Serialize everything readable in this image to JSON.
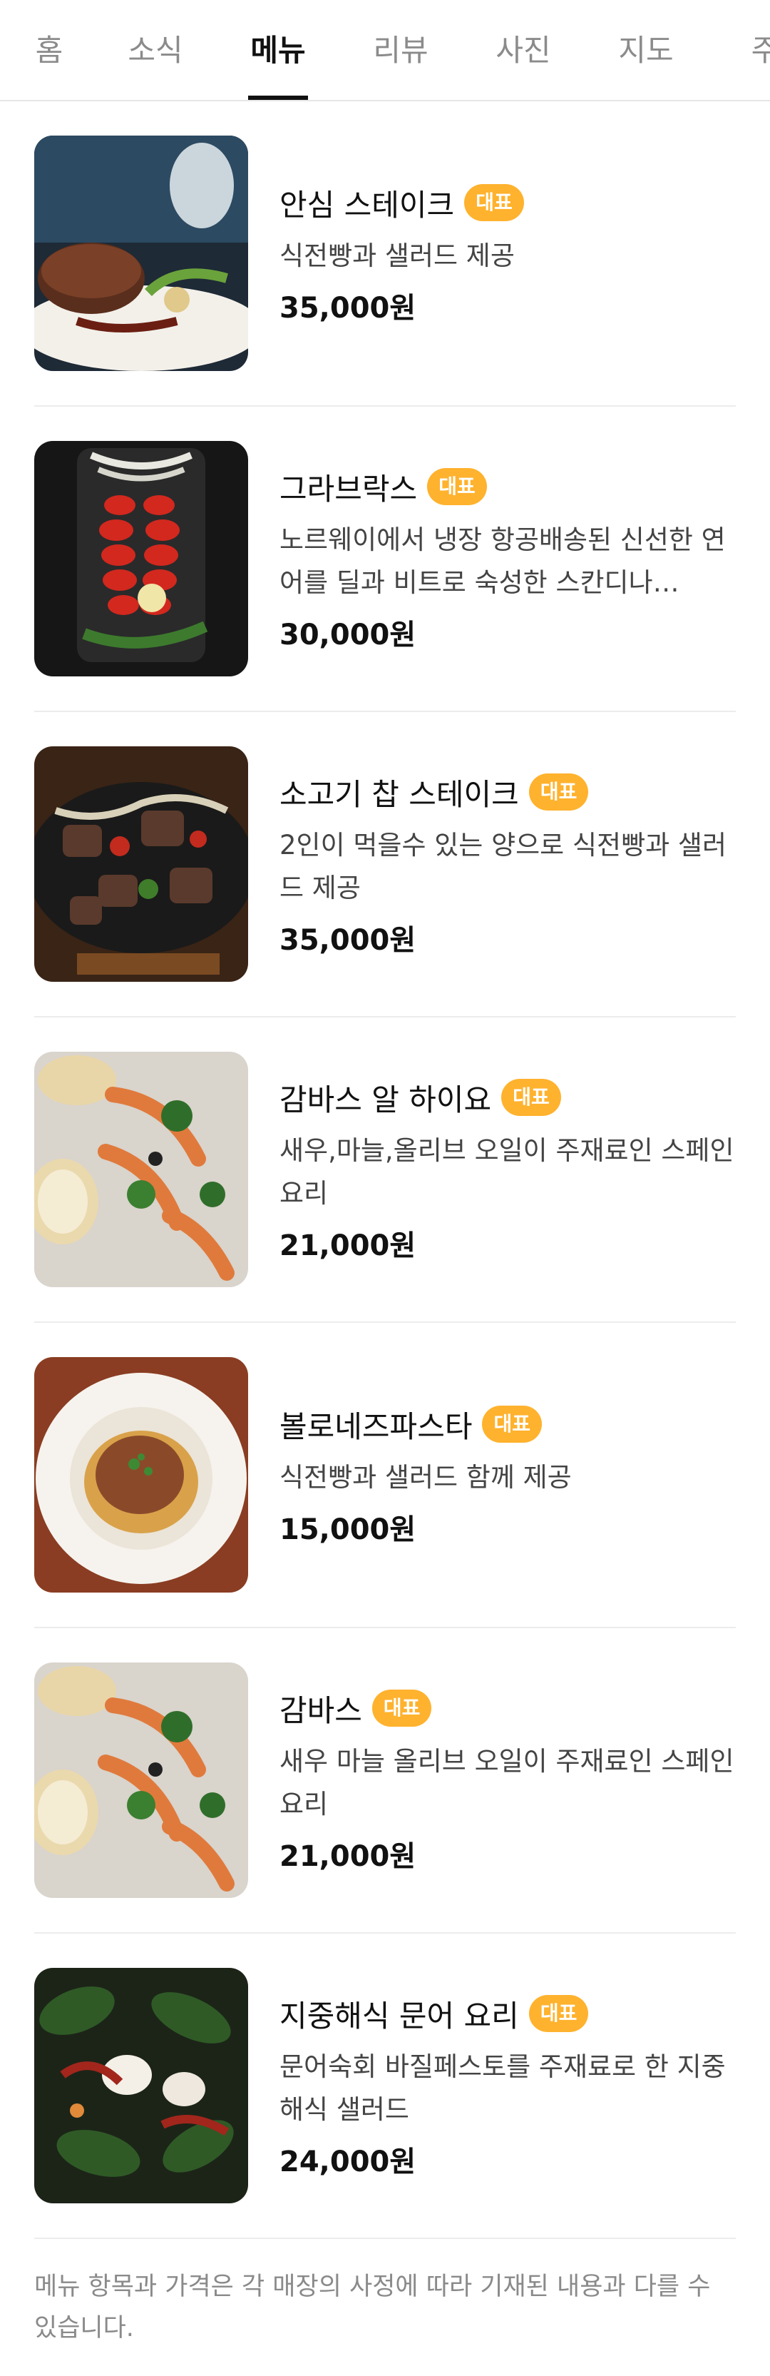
{
  "tabs": [
    {
      "label": "홈",
      "active": false
    },
    {
      "label": "소식",
      "active": false
    },
    {
      "label": "메뉴",
      "active": true
    },
    {
      "label": "리뷰",
      "active": false
    },
    {
      "label": "사진",
      "active": false
    },
    {
      "label": "지도",
      "active": false
    },
    {
      "label": "주",
      "active": false
    }
  ],
  "badge_color": "#ffb22e",
  "menu_items": [
    {
      "name": "안심 스테이크",
      "badge": "대표",
      "desc": "식전빵과 샐러드 제공",
      "price": "35,000원",
      "image": "steak-photo"
    },
    {
      "name": "그라브락스",
      "badge": "대표",
      "desc": "노르웨이에서 냉장 항공배송된 신선한 연어를 딜과 비트로 숙성한 스칸디나…",
      "price": "30,000원",
      "image": "gravlax-photo"
    },
    {
      "name": "소고기 찹 스테이크",
      "badge": "대표",
      "desc": "2인이 먹을수 있는 양으로 식전빵과 샐러드 제공",
      "price": "35,000원",
      "image": "chop-steak-photo"
    },
    {
      "name": "감바스 알 하이요",
      "badge": "대표",
      "desc": "새우,마늘,올리브 오일이 주재료인 스페인 요리",
      "price": "21,000원",
      "image": "gambas-photo"
    },
    {
      "name": "볼로네즈파스타",
      "badge": "대표",
      "desc": "식전빵과 샐러드 함께 제공",
      "price": "15,000원",
      "image": "bolognese-photo"
    },
    {
      "name": "감바스",
      "badge": "대표",
      "desc": "새우 마늘 올리브 오일이 주재료인 스페인 요리",
      "price": "21,000원",
      "image": "gambas-photo"
    },
    {
      "name": "지중해식 문어 요리",
      "badge": "대표",
      "desc": "문어숙회 바질페스토를 주재료로 한 지중해식 샐러드",
      "price": "24,000원",
      "image": "octopus-photo"
    }
  ],
  "notice": "메뉴 항목과 가격은 각 매장의 사정에 따라 기재된 내용과 다를 수 있습니다."
}
